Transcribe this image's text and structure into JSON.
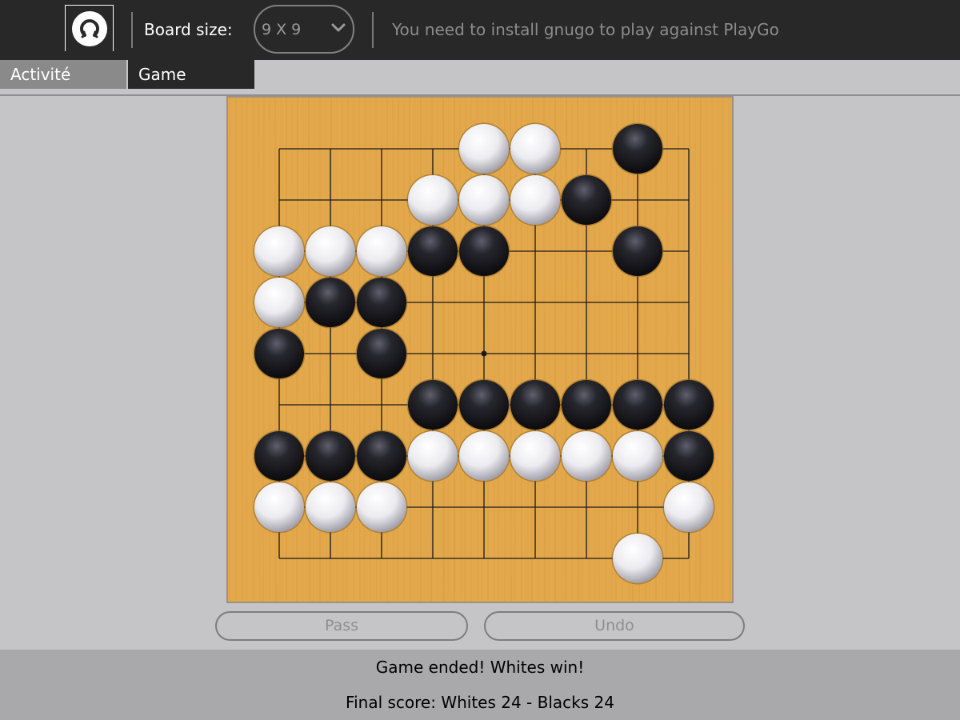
{
  "toolbar": {
    "activity_icon": "playgo-activity-icon",
    "board_size_label": "Board size:",
    "board_size_value": "9 X 9",
    "board_size_chevron": "chevron-down-icon",
    "status_message": "You need to install gnugo to play against PlayGo"
  },
  "tabs": {
    "activity": "Activité",
    "game": "Game"
  },
  "game": {
    "size": 9,
    "hoshi": [
      [
        4,
        4
      ]
    ],
    "colors": {
      "board": "#e2a84b",
      "grain": "#c98e30",
      "line": "#1a1a1a"
    },
    "stones": {
      "black": [
        [
          7,
          0
        ],
        [
          6,
          1
        ],
        [
          3,
          2
        ],
        [
          4,
          2
        ],
        [
          7,
          2
        ],
        [
          1,
          3
        ],
        [
          2,
          3
        ],
        [
          0,
          4
        ],
        [
          2,
          4
        ],
        [
          3,
          5
        ],
        [
          4,
          5
        ],
        [
          5,
          5
        ],
        [
          6,
          5
        ],
        [
          7,
          5
        ],
        [
          8,
          5
        ],
        [
          0,
          6
        ],
        [
          1,
          6
        ],
        [
          2,
          6
        ],
        [
          8,
          6
        ]
      ],
      "white": [
        [
          4,
          0
        ],
        [
          5,
          0
        ],
        [
          3,
          1
        ],
        [
          4,
          1
        ],
        [
          5,
          1
        ],
        [
          0,
          2
        ],
        [
          1,
          2
        ],
        [
          2,
          2
        ],
        [
          0,
          3
        ],
        [
          3,
          6
        ],
        [
          4,
          6
        ],
        [
          5,
          6
        ],
        [
          6,
          6
        ],
        [
          7,
          6
        ],
        [
          0,
          7
        ],
        [
          1,
          7
        ],
        [
          2,
          7
        ],
        [
          8,
          7
        ],
        [
          7,
          8
        ]
      ]
    }
  },
  "buttons": {
    "pass": "Pass",
    "undo": "Undo"
  },
  "footer": {
    "result": "Game ended! Whites win!",
    "score": "Final score: Whites 24 - Blacks 24"
  }
}
